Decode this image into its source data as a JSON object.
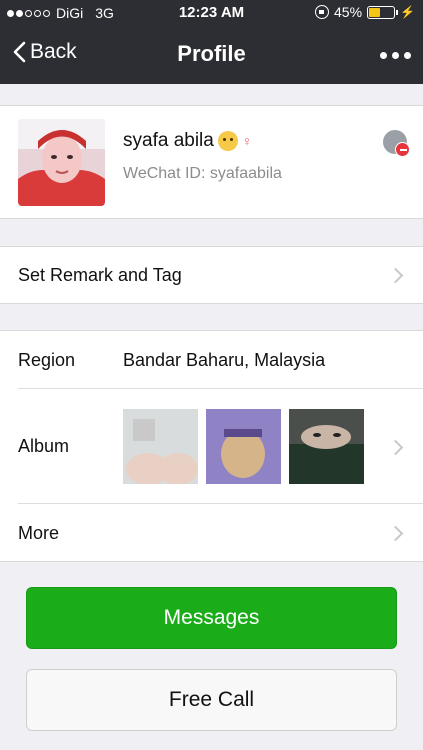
{
  "status_bar": {
    "carrier": "DiGi",
    "network": "3G",
    "time": "12:23 AM",
    "battery_percent": "45%",
    "battery_level": 0.45,
    "signal_bars_filled": 2,
    "signal_bars_total": 5
  },
  "nav": {
    "back_label": "Back",
    "title": "Profile"
  },
  "profile": {
    "name": "syafa abila",
    "wechat_id": "WeChat ID: syafaabila"
  },
  "rows": {
    "remark_label": "Set Remark and Tag",
    "region_label": "Region",
    "region_value": "Bandar Baharu, Malaysia",
    "album_label": "Album",
    "more_label": "More"
  },
  "buttons": {
    "messages": "Messages",
    "free_call": "Free Call"
  },
  "colors": {
    "nav_bg": "#2d2e33",
    "primary_green": "#1aad19",
    "battery_fill": "#f5c518"
  }
}
